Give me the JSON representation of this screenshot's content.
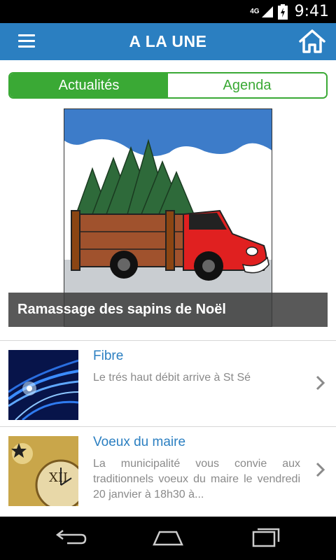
{
  "status": {
    "network": "4G",
    "time": "9:41"
  },
  "header": {
    "title": "A LA UNE"
  },
  "tabs": [
    {
      "label": "Actualités",
      "active": true
    },
    {
      "label": "Agenda",
      "active": false
    }
  ],
  "featured": {
    "caption": "Ramassage des sapins de Noël"
  },
  "news": [
    {
      "title": "Fibre",
      "description": "Le trés haut débit arrive à St Sé"
    },
    {
      "title": "Voeux du maire",
      "description": "La municipalité vous convie aux traditionnels voeux du maire le vendredi 20 janvier à 18h30 à..."
    }
  ],
  "colors": {
    "appbar": "#2b7fc1",
    "accent_green": "#3aa935",
    "title_blue": "#2b7fc1"
  },
  "icons": {
    "menu": "menu-icon",
    "home": "home-icon",
    "chevron": "chevron-right-icon",
    "back": "back-icon",
    "nav_home": "nav-home-icon",
    "recents": "recent-apps-icon"
  }
}
